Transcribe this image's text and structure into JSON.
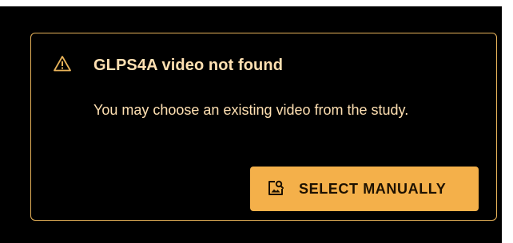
{
  "alert": {
    "icon": "warning-triangle-icon",
    "title": "GLPS4A video not found",
    "message": "You may choose an existing video from the study.",
    "border_color": "#e8b35a",
    "text_color": "#ffe0b2"
  },
  "action": {
    "icon": "image-search-icon",
    "label": "SELECT MANUALLY",
    "background_color": "#f4b04a",
    "text_color": "#1d1100"
  }
}
